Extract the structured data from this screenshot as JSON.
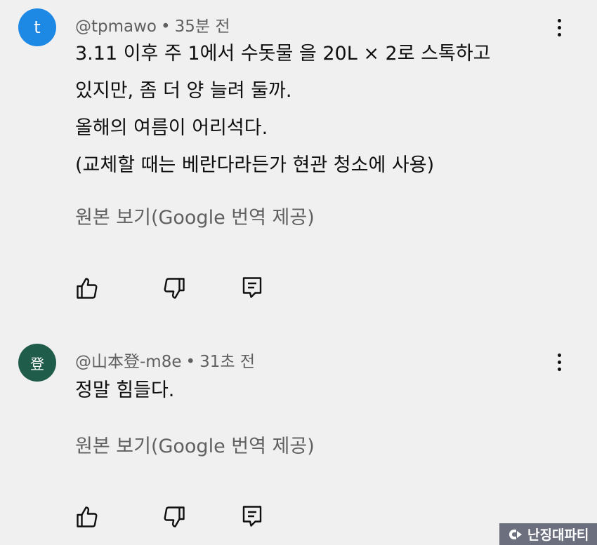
{
  "comments": [
    {
      "avatar_letter": "t",
      "avatar_color": "#1e88e5",
      "handle": "@tpmawo",
      "separator": "•",
      "time": "35분 전",
      "lines": [
        "3.11 이후 주 1에서 수돗물 을 20L × 2로 스톡하고",
        "있지만, 좀 더 양 늘려 둘까.",
        "올해의 여름이 어리석다.",
        "(교체할 때는 베란다라든가 현관 청소에 사용)"
      ],
      "translate_label": "원본 보기(Google 번역 제공)"
    },
    {
      "avatar_letter": "登",
      "avatar_color": "#1f5d4a",
      "handle": "@山本登-m8e",
      "separator": "•",
      "time": "31초 전",
      "lines": [
        "정말 힘들다."
      ],
      "translate_label": "원본 보기(Google 번역 제공)"
    }
  ],
  "actions": {
    "like_icon": "thumb-up-icon",
    "dislike_icon": "thumb-down-icon",
    "reply_icon": "comment-reply-icon",
    "more_icon": "more-vert-icon"
  },
  "watermark": {
    "text": "난징대파티",
    "background": "#6b6f7e"
  }
}
